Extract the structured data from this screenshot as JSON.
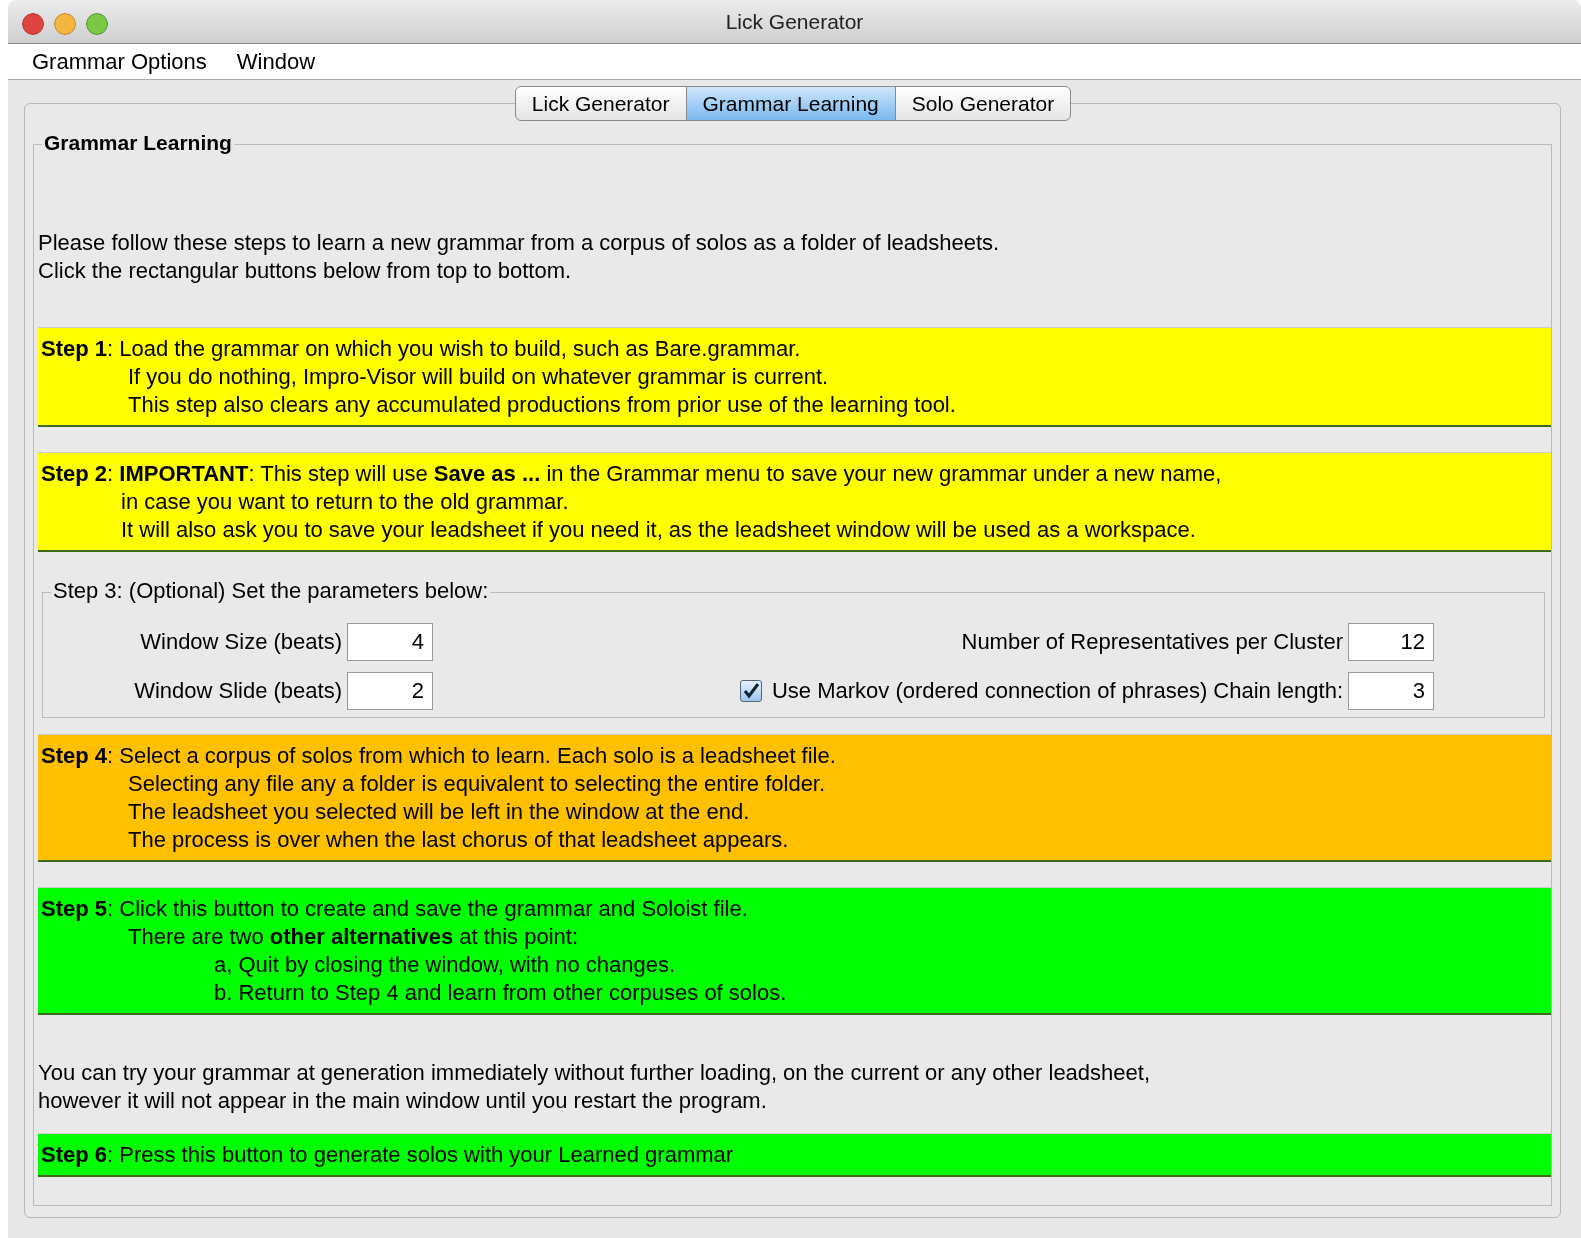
{
  "window": {
    "title": "Lick Generator"
  },
  "menu": [
    "Grammar Options",
    "Window"
  ],
  "tabs": [
    {
      "label": "Lick Generator",
      "selected": false
    },
    {
      "label": "Grammar Learning",
      "selected": true
    },
    {
      "label": "Solo Generator",
      "selected": false
    }
  ],
  "panel": {
    "title": "Grammar Learning",
    "intro": [
      "Please follow these steps to learn a new grammar from a corpus of solos as a folder of leadsheets.",
      "Click the rectangular buttons below from top to bottom."
    ],
    "steps_before": [
      {
        "color": "#ffff00",
        "lines": [
          {
            "kind": "first",
            "text": "**Step 1**: Load the grammar on which you wish to build, such as Bare.grammar."
          },
          {
            "kind": "sub",
            "text": "If you do nothing, Impro-Visor will build on whatever grammar is current."
          },
          {
            "kind": "sub",
            "text": "This step also clears any accumulated productions from prior use of the learning tool."
          }
        ]
      },
      {
        "color": "#ffff00",
        "lines": [
          {
            "kind": "first",
            "text": "**Step 2**: **IMPORTANT**: This step will use **Save as ...** in the Grammar menu to save your new grammar under a new name,"
          },
          {
            "kind": "sub2",
            "text": "in case you want to return to the old grammar."
          },
          {
            "kind": "sub2",
            "text": "It will also ask you to save your leadsheet if you need it, as the leadsheet window will be used as a workspace."
          }
        ]
      }
    ],
    "parameters": {
      "title": "Step 3: (Optional) Set the parameters below:",
      "window_size": {
        "label": "Window Size (beats)",
        "value": "4"
      },
      "window_slide": {
        "label": "Window Slide (beats)",
        "value": "2"
      },
      "representatives": {
        "label": "Number of Representatives per Cluster",
        "value": "12"
      },
      "markov": {
        "label": "Use Markov (ordered connection of phrases) Chain length:",
        "checked": true,
        "value": "3"
      }
    },
    "steps_after": [
      {
        "color": "#ffc000",
        "lines": [
          {
            "kind": "first",
            "text": "**Step 4**: Select a corpus of solos from which to learn. Each solo is a leadsheet file."
          },
          {
            "kind": "sub",
            "text": "Selecting any file any a folder is equivalent to selecting the entire folder."
          },
          {
            "kind": "sub",
            "text": "The leadsheet you selected will be left in the window at the end."
          },
          {
            "kind": "sub",
            "text": "The process is over when the last chorus of that leadsheet appears."
          }
        ]
      },
      {
        "color": "#00ff00",
        "lines": [
          {
            "kind": "first",
            "text": "**Step 5**: Click this button to create and save the grammar and Soloist file."
          },
          {
            "kind": "sub",
            "text": "There are two **other alternatives** at this point:"
          },
          {
            "kind": "subsub",
            "text": "a, Quit by closing the window, with no changes."
          },
          {
            "kind": "subsub",
            "text": "b. Return to Step 4 and learn from other corpuses of solos."
          }
        ]
      }
    ],
    "note": [
      "You can try your grammar at generation immediately without further loading, on the current or any other leadsheet,",
      "however it will not appear in the main window until you restart the program."
    ],
    "final_step": {
      "color": "#00ff00",
      "lines": [
        {
          "kind": "first",
          "text": "**Step 6**: Press this button to generate solos with your Learned grammar"
        }
      ]
    }
  }
}
